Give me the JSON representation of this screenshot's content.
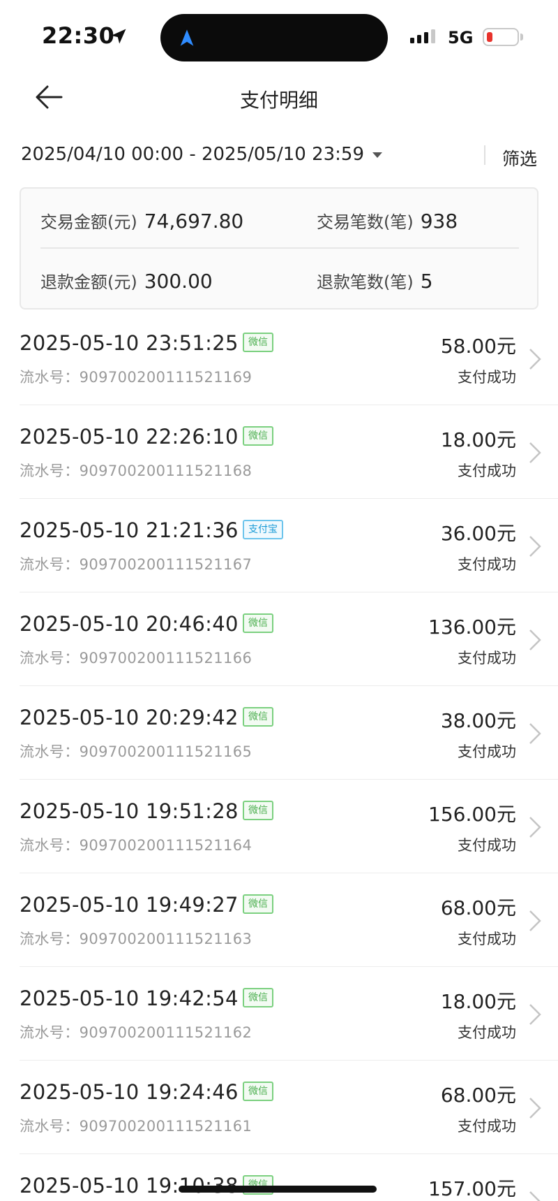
{
  "status_bar": {
    "time": "22:30",
    "network": "5G",
    "location_icon": "location-arrow-icon",
    "battery_color": "#e8332c"
  },
  "header": {
    "title": "支付明细",
    "back_icon": "back-arrow-icon"
  },
  "filter": {
    "date_range": "2025/04/10 00:00 - 2025/05/10 23:59",
    "filter_label": "筛选"
  },
  "summary": {
    "trade_amount_label": "交易金额(元)",
    "trade_amount_value": "74,697.80",
    "trade_count_label": "交易笔数(笔)",
    "trade_count_value": "938",
    "refund_amount_label": "退款金额(元)",
    "refund_amount_value": "300.00",
    "refund_count_label": "退款笔数(笔)",
    "refund_count_value": "5"
  },
  "colors": {
    "wechat": "#4caf50",
    "alipay": "#1a9bd7"
  },
  "transactions": [
    {
      "time": "2025-05-10 23:51:25",
      "channel": "微信",
      "channel_type": "wechat",
      "serial": "流水号：909700200111521169",
      "amount": "58.00元",
      "status": "支付成功"
    },
    {
      "time": "2025-05-10 22:26:10",
      "channel": "微信",
      "channel_type": "wechat",
      "serial": "流水号：909700200111521168",
      "amount": "18.00元",
      "status": "支付成功"
    },
    {
      "time": "2025-05-10 21:21:36",
      "channel": "支付宝",
      "channel_type": "alipay",
      "serial": "流水号：909700200111521167",
      "amount": "36.00元",
      "status": "支付成功"
    },
    {
      "time": "2025-05-10 20:46:40",
      "channel": "微信",
      "channel_type": "wechat",
      "serial": "流水号：909700200111521166",
      "amount": "136.00元",
      "status": "支付成功"
    },
    {
      "time": "2025-05-10 20:29:42",
      "channel": "微信",
      "channel_type": "wechat",
      "serial": "流水号：909700200111521165",
      "amount": "38.00元",
      "status": "支付成功"
    },
    {
      "time": "2025-05-10 19:51:28",
      "channel": "微信",
      "channel_type": "wechat",
      "serial": "流水号：909700200111521164",
      "amount": "156.00元",
      "status": "支付成功"
    },
    {
      "time": "2025-05-10 19:49:27",
      "channel": "微信",
      "channel_type": "wechat",
      "serial": "流水号：909700200111521163",
      "amount": "68.00元",
      "status": "支付成功"
    },
    {
      "time": "2025-05-10 19:42:54",
      "channel": "微信",
      "channel_type": "wechat",
      "serial": "流水号：909700200111521162",
      "amount": "18.00元",
      "status": "支付成功"
    },
    {
      "time": "2025-05-10 19:24:46",
      "channel": "微信",
      "channel_type": "wechat",
      "serial": "流水号：909700200111521161",
      "amount": "68.00元",
      "status": "支付成功"
    },
    {
      "time": "2025-05-10 19:10:38",
      "channel": "微信",
      "channel_type": "wechat",
      "serial": "",
      "amount": "157.00元",
      "status": ""
    }
  ]
}
